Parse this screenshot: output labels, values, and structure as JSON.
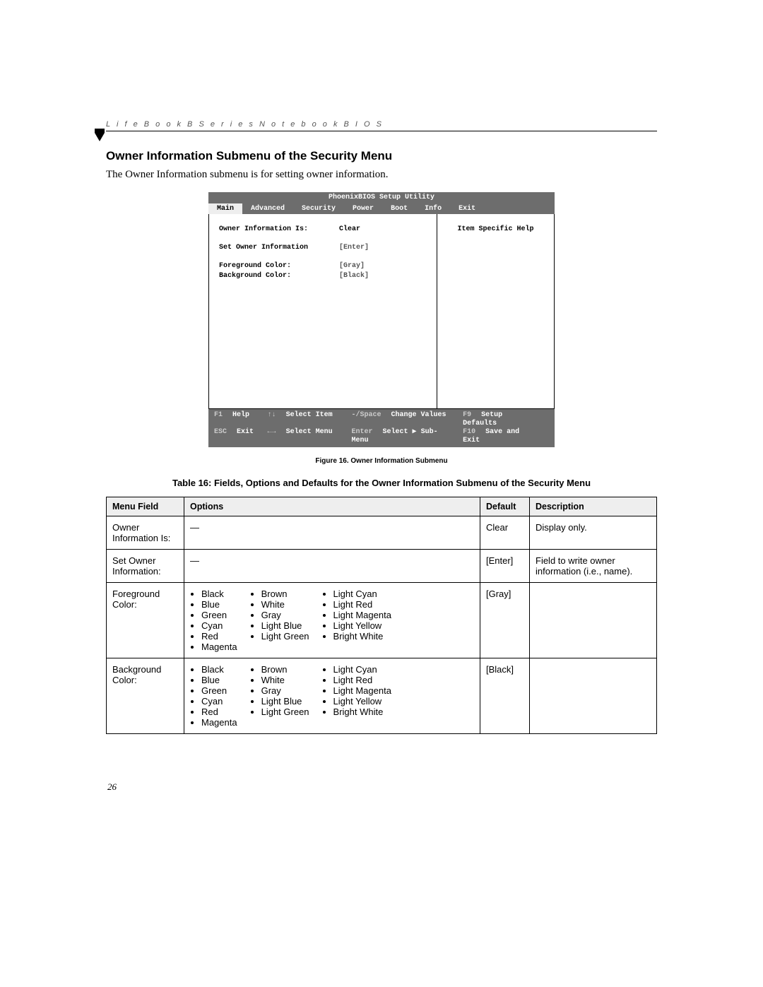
{
  "header": {
    "running": "L i f e B o o k   B   S e r i e s   N o t e b o o k   B I O S"
  },
  "section": {
    "title": "Owner Information Submenu of the Security Menu",
    "intro": "The Owner Information submenu is for setting owner information."
  },
  "bios": {
    "title": "PhoenixBIOS Setup Utility",
    "tabs": [
      "Main",
      "Advanced",
      "Security",
      "Power",
      "Boot",
      "Info",
      "Exit"
    ],
    "active_tab": "Main",
    "help_panel_title": "Item Specific Help",
    "rows": {
      "r1_label": "Owner Information Is:",
      "r1_value": "Clear",
      "r2_label": "Set Owner Information",
      "r2_value": "[Enter]",
      "r3_label": "Foreground Color:",
      "r3_value": "[Gray]",
      "r4_label": "Background Color:",
      "r4_value": "[Black]"
    },
    "footer": {
      "f1_key": "F1",
      "f1_label": "Help",
      "sel_item_key": "↑↓",
      "sel_item_label": "Select Item",
      "change_key": "-/Space",
      "change_label": "Change Values",
      "f9_key": "F9",
      "f9_label": "Setup Defaults",
      "esc_key": "ESC",
      "esc_label": "Exit",
      "sel_menu_key": "←→",
      "sel_menu_label": "Select Menu",
      "enter_key": "Enter",
      "enter_label": "Select ▶ Sub-Menu",
      "f10_key": "F10",
      "f10_label": "Save and Exit"
    }
  },
  "figure_caption": "Figure 16.   Owner Information Submenu",
  "table_title": "Table 16: Fields, Options and Defaults for the Owner Information Submenu of the Security Menu",
  "table": {
    "headers": {
      "menu_field": "Menu Field",
      "options": "Options",
      "default": "Default",
      "description": "Description"
    },
    "rows": {
      "r1": {
        "field": "Owner Information Is:",
        "options_dash": "—",
        "default": "Clear",
        "desc": "Display only."
      },
      "r2": {
        "field": "Set Owner Information:",
        "options_dash": "—",
        "default": "[Enter]",
        "desc": "Field to write owner information (i.e., name)."
      },
      "r3": {
        "field": "Foreground Color:",
        "default": "[Gray]",
        "desc": "",
        "col1": [
          "Black",
          "Blue",
          "Green",
          "Cyan",
          "Red",
          "Magenta"
        ],
        "col2": [
          "Brown",
          "White",
          "Gray",
          "Light Blue",
          "Light Green"
        ],
        "col3": [
          "Light Cyan",
          "Light Red",
          "Light Magenta",
          "Light Yellow",
          "Bright White"
        ]
      },
      "r4": {
        "field": "Background Color:",
        "default": "[Black]",
        "desc": "",
        "col1": [
          "Black",
          "Blue",
          "Green",
          "Cyan",
          "Red",
          "Magenta"
        ],
        "col2": [
          "Brown",
          "White",
          "Gray",
          "Light Blue",
          "Light Green"
        ],
        "col3": [
          "Light Cyan",
          "Light Red",
          "Light Magenta",
          "Light Yellow",
          "Bright White"
        ]
      }
    }
  },
  "page_number": "26"
}
